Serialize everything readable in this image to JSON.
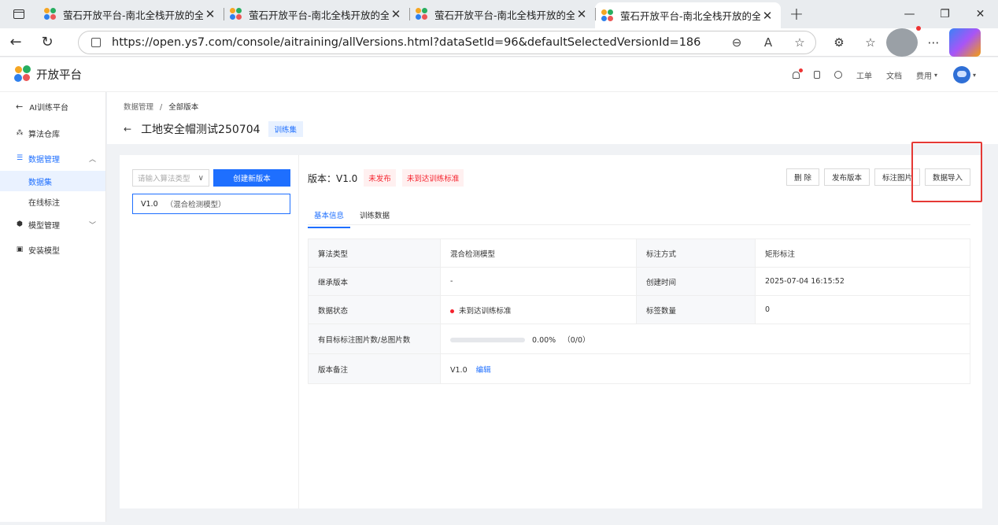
{
  "browser": {
    "tabs": [
      {
        "title": "萤石开放平台-南北全栈开放的全"
      },
      {
        "title": "萤石开放平台-南北全栈开放的全"
      },
      {
        "title": "萤石开放平台-南北全栈开放的全"
      },
      {
        "title": "萤石开放平台-南北全栈开放的全"
      }
    ],
    "url": "https://open.ys7.com/console/aitraining/allVersions.html?dataSetId=96&defaultSelectedVersionId=186"
  },
  "header": {
    "brand": "开放平台",
    "links": {
      "ticket": "工单",
      "docs": "文档",
      "billing": "费用"
    }
  },
  "sidebar": {
    "back_label": "AI训练平台",
    "items": [
      {
        "label": "算法仓库"
      },
      {
        "label": "数据管理"
      },
      {
        "label": "模型管理"
      },
      {
        "label": "安装模型"
      }
    ],
    "sub_items": [
      {
        "label": "数据集"
      },
      {
        "label": "在线标注"
      }
    ]
  },
  "page": {
    "breadcrumb": {
      "parent": "数据管理",
      "sep": "/",
      "current": "全部版本"
    },
    "title": "工地安全帽测试250704",
    "tag": "训练集"
  },
  "left": {
    "select_placeholder": "请输入算法类型",
    "create_button": "创建新版本",
    "version_item": {
      "version": "V1.0",
      "model": "（混合检测模型）"
    }
  },
  "version": {
    "label": "版本：V1.0",
    "status1": "未发布",
    "status2": "未到达训练标准",
    "actions": {
      "delete": "删 除",
      "publish": "发布版本",
      "annotate": "标注图片",
      "import": "数据导入"
    },
    "tabs": {
      "basic": "基本信息",
      "train": "训练数据"
    }
  },
  "info": {
    "algo_type_k": "算法类型",
    "algo_type_v": "混合检测模型",
    "anno_method_k": "标注方式",
    "anno_method_v": "矩形标注",
    "inherit_k": "继承版本",
    "inherit_v": "-",
    "created_k": "创建时间",
    "created_v": "2025-07-04 16:15:52",
    "status_k": "数据状态",
    "status_v": "未到达训练标准",
    "label_count_k": "标签数量",
    "label_count_v": "0",
    "ratio_k": "有目标标注图片数/总图片数",
    "ratio_percent": "0.00%",
    "ratio_count": "（0/0）",
    "ratio_fraction": 0,
    "note_k": "版本备注",
    "note_v": "V1.0",
    "note_edit": "编辑"
  },
  "colors": {
    "accent": "#1e6fff",
    "danger": "#f5222d",
    "highlight": "#e53935"
  }
}
